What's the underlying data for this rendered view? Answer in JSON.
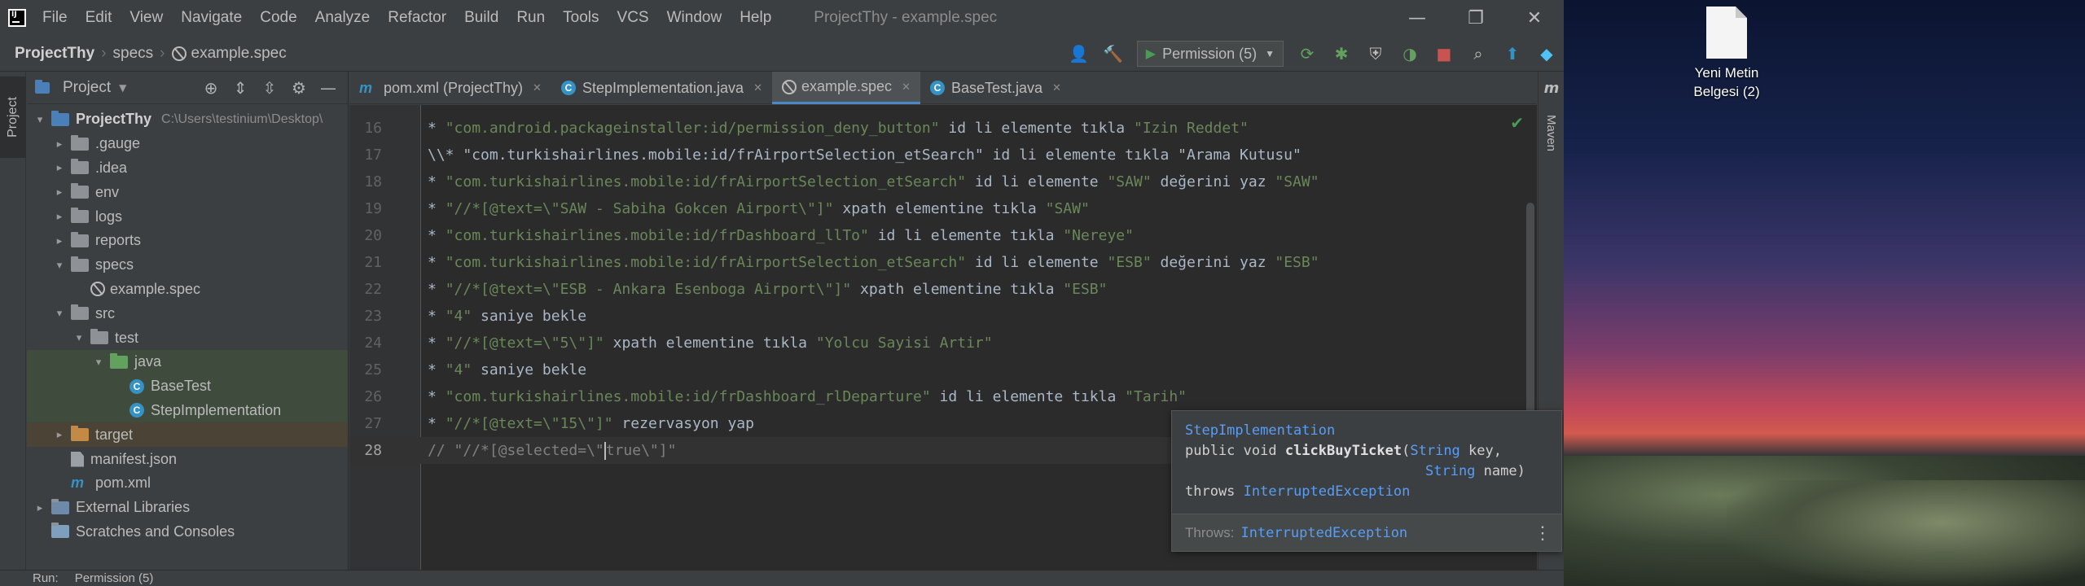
{
  "window": {
    "title": "ProjectThy - example.spec",
    "controls": [
      "—",
      "❐",
      "✕"
    ]
  },
  "menu": [
    "File",
    "Edit",
    "View",
    "Navigate",
    "Code",
    "Analyze",
    "Refactor",
    "Build",
    "Run",
    "Tools",
    "VCS",
    "Window",
    "Help"
  ],
  "breadcrumb": {
    "project": "ProjectThy",
    "folder": "specs",
    "file": "example.spec"
  },
  "run_config": {
    "label": "Permission (5)"
  },
  "left_strip": {
    "project_tab": "Project"
  },
  "project_panel": {
    "title": "Project",
    "tree": [
      {
        "label": "ProjectThy",
        "path": "C:\\Users\\testinium\\Desktop\\",
        "indent": 0,
        "arrow": "▾",
        "icon": "folder-blue",
        "bold": true
      },
      {
        "label": ".gauge",
        "indent": 1,
        "arrow": "▸",
        "icon": "folder"
      },
      {
        "label": ".idea",
        "indent": 1,
        "arrow": "▸",
        "icon": "folder"
      },
      {
        "label": "env",
        "indent": 1,
        "arrow": "▸",
        "icon": "folder"
      },
      {
        "label": "logs",
        "indent": 1,
        "arrow": "▸",
        "icon": "folder"
      },
      {
        "label": "reports",
        "indent": 1,
        "arrow": "▸",
        "icon": "folder"
      },
      {
        "label": "specs",
        "indent": 1,
        "arrow": "▾",
        "icon": "folder"
      },
      {
        "label": "example.spec",
        "indent": 2,
        "arrow": "",
        "icon": "spec"
      },
      {
        "label": "src",
        "indent": 1,
        "arrow": "▾",
        "icon": "folder"
      },
      {
        "label": "test",
        "indent": 2,
        "arrow": "▾",
        "icon": "folder"
      },
      {
        "label": "java",
        "indent": 3,
        "arrow": "▾",
        "icon": "folder-green",
        "highlight": "green"
      },
      {
        "label": "BaseTest",
        "indent": 4,
        "arrow": "",
        "icon": "class",
        "highlight": "green"
      },
      {
        "label": "StepImplementation",
        "indent": 4,
        "arrow": "",
        "icon": "class",
        "highlight": "green"
      },
      {
        "label": "target",
        "indent": 1,
        "arrow": "▸",
        "icon": "folder-orange",
        "highlight": "orange"
      },
      {
        "label": "manifest.json",
        "indent": 1,
        "arrow": "",
        "icon": "file"
      },
      {
        "label": "pom.xml",
        "indent": 1,
        "arrow": "",
        "icon": "maven"
      },
      {
        "label": "External Libraries",
        "indent": 0,
        "arrow": "▸",
        "icon": "folder-lib"
      },
      {
        "label": "Scratches and Consoles",
        "indent": 0,
        "arrow": "",
        "icon": "scratch"
      }
    ]
  },
  "tabs": [
    {
      "label": "pom.xml (ProjectThy)",
      "icon": "maven",
      "active": false
    },
    {
      "label": "StepImplementation.java",
      "icon": "class",
      "active": false
    },
    {
      "label": "example.spec",
      "icon": "spec",
      "active": true
    },
    {
      "label": "BaseTest.java",
      "icon": "class",
      "active": false
    }
  ],
  "editor": {
    "lines": [
      {
        "n": "16",
        "parts": [
          [
            "* ",
            "t"
          ],
          [
            "\"com.android.packageinstaller:id/permission_deny_button\"",
            "q"
          ],
          [
            " id li elemente tıkla ",
            "t"
          ],
          [
            "\"Izin Reddet\"",
            "q"
          ]
        ]
      },
      {
        "n": "17",
        "parts": [
          [
            "\\\\* \"com.turkishairlines.mobile:id/frAirportSelection_etSearch\" id li elemente tıkla \"Arama Kutusu\"",
            "t"
          ]
        ]
      },
      {
        "n": "18",
        "parts": [
          [
            "* ",
            "t"
          ],
          [
            "\"com.turkishairlines.mobile:id/frAirportSelection_etSearch\"",
            "q"
          ],
          [
            " id li elemente ",
            "t"
          ],
          [
            "\"SAW\"",
            "q"
          ],
          [
            " değerini yaz ",
            "t"
          ],
          [
            "\"SAW\"",
            "q"
          ]
        ]
      },
      {
        "n": "19",
        "parts": [
          [
            "* ",
            "t"
          ],
          [
            "\"//*[@text=\\\"SAW - Sabiha Gokcen Airport\\\"]\"",
            "q"
          ],
          [
            " xpath elementine tıkla ",
            "t"
          ],
          [
            "\"SAW\"",
            "q"
          ]
        ]
      },
      {
        "n": "20",
        "parts": [
          [
            "* ",
            "t"
          ],
          [
            "\"com.turkishairlines.mobile:id/frDashboard_llTo\"",
            "q"
          ],
          [
            " id li elemente tıkla ",
            "t"
          ],
          [
            "\"Nereye\"",
            "q"
          ]
        ]
      },
      {
        "n": "21",
        "parts": [
          [
            "* ",
            "t"
          ],
          [
            "\"com.turkishairlines.mobile:id/frAirportSelection_etSearch\"",
            "q"
          ],
          [
            " id li elemente ",
            "t"
          ],
          [
            "\"ESB\"",
            "q"
          ],
          [
            " değerini yaz ",
            "t"
          ],
          [
            "\"ESB\"",
            "q"
          ]
        ]
      },
      {
        "n": "22",
        "parts": [
          [
            "* ",
            "t"
          ],
          [
            "\"//*[@text=\\\"ESB - Ankara Esenboga Airport\\\"]\"",
            "q"
          ],
          [
            " xpath elementine tıkla ",
            "t"
          ],
          [
            "\"ESB\"",
            "q"
          ]
        ]
      },
      {
        "n": "23",
        "parts": [
          [
            "* ",
            "t"
          ],
          [
            "\"4\"",
            "q"
          ],
          [
            " saniye bekle",
            "t"
          ]
        ]
      },
      {
        "n": "24",
        "parts": [
          [
            "* ",
            "t"
          ],
          [
            "\"//*[@text=\\\"5\\\"]\"",
            "q"
          ],
          [
            " xpath elementine tıkla ",
            "t"
          ],
          [
            "\"Yolcu Sayisi Artir\"",
            "q"
          ]
        ]
      },
      {
        "n": "25",
        "parts": [
          [
            "* ",
            "t"
          ],
          [
            "\"4\"",
            "q"
          ],
          [
            " saniye bekle",
            "t"
          ]
        ]
      },
      {
        "n": "26",
        "parts": [
          [
            "* ",
            "t"
          ],
          [
            "\"com.turkishairlines.mobile:id/frDashboard_rlDeparture\"",
            "q"
          ],
          [
            " id li elemente tıkla ",
            "t"
          ],
          [
            "\"Tarih\"",
            "q"
          ]
        ]
      },
      {
        "n": "27",
        "parts": [
          [
            "* ",
            "t"
          ],
          [
            "\"//*[@text=\\\"15\\\"]\"",
            "q"
          ],
          [
            " rezervasyon yap",
            "t"
          ]
        ]
      },
      {
        "n": "28",
        "parts": [
          [
            "// \"//*[@selected=\\\"",
            "c"
          ],
          [
            "|",
            "cursor"
          ],
          [
            "true\\\"]\"",
            "c"
          ]
        ],
        "current": true
      }
    ]
  },
  "tooltip": {
    "class_name": "StepImplementation",
    "sig_prefix": "public void ",
    "method": "clickBuyTicket",
    "type1": "String",
    "param1": " key,",
    "type2": "String",
    "param2": " name)",
    "throws_kw": "throws ",
    "exception": "InterruptedException",
    "footer_label": "Throws:",
    "footer_exception": "InterruptedException"
  },
  "right_strip": {
    "maven_label": "Maven"
  },
  "bottom_bar": {
    "run_label": "Run:",
    "config_label": "Permission (5)"
  },
  "desktop": {
    "file_label_line1": "Yeni Metin",
    "file_label_line2": "Belgesi (2)"
  },
  "colors": {
    "string": "#6a8759",
    "text": "#a9b7c6",
    "comment": "#808080",
    "link": "#589df6",
    "accent": "#4a88c7"
  }
}
